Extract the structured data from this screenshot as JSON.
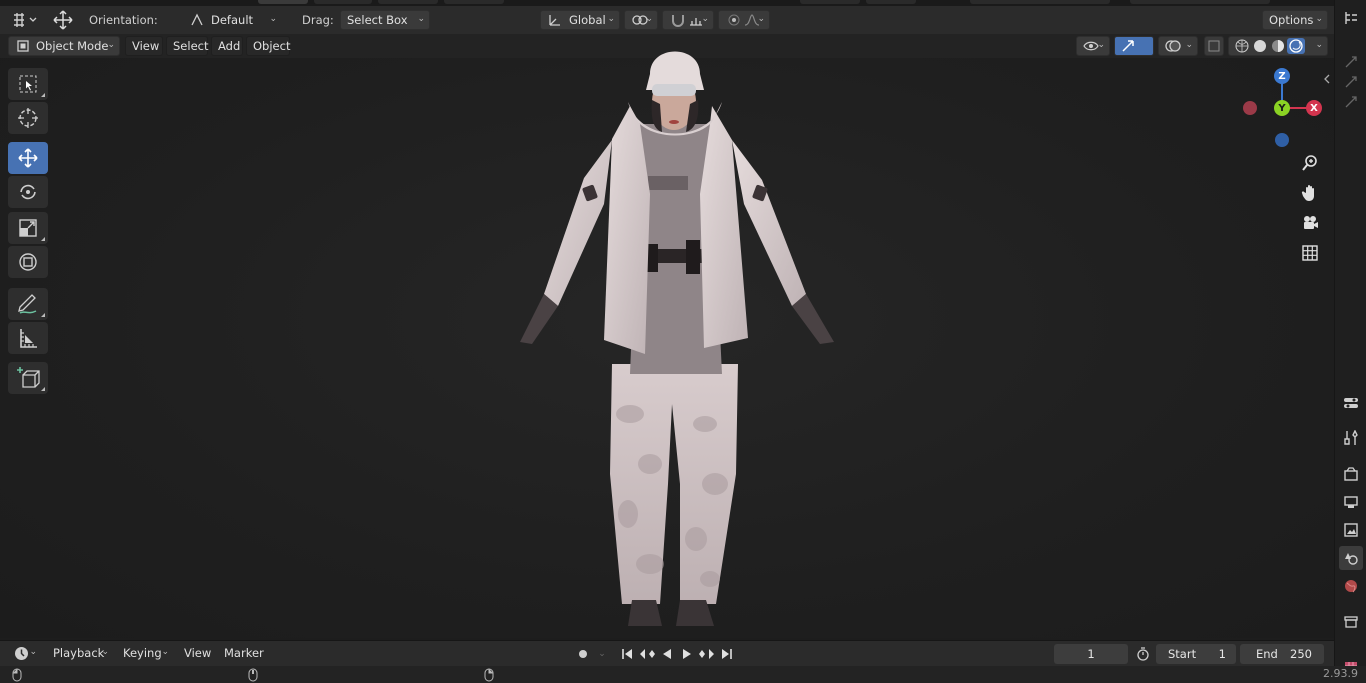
{
  "header": {
    "orientation_label": "Orientation:",
    "orientation_value": "Default",
    "drag_label": "Drag:",
    "drag_value": "Select Box",
    "transform_space": "Global",
    "options_label": "Options"
  },
  "viewport_header": {
    "mode": "Object Mode",
    "menus": [
      "View",
      "Select",
      "Add",
      "Object"
    ]
  },
  "gizmo": {
    "z": "Z",
    "y": "Y",
    "x": "X"
  },
  "timeline": {
    "menus": [
      "Playback",
      "Keying",
      "View",
      "Marker"
    ],
    "current_frame": "1",
    "start_label": "Start",
    "start_value": "1",
    "end_label": "End",
    "end_value": "250"
  },
  "status": {
    "version": "2.93.9"
  },
  "colors": {
    "accent": "#4772b3",
    "axis_x": "#d3354f",
    "axis_y": "#8bd224",
    "axis_z": "#3b79d1"
  }
}
